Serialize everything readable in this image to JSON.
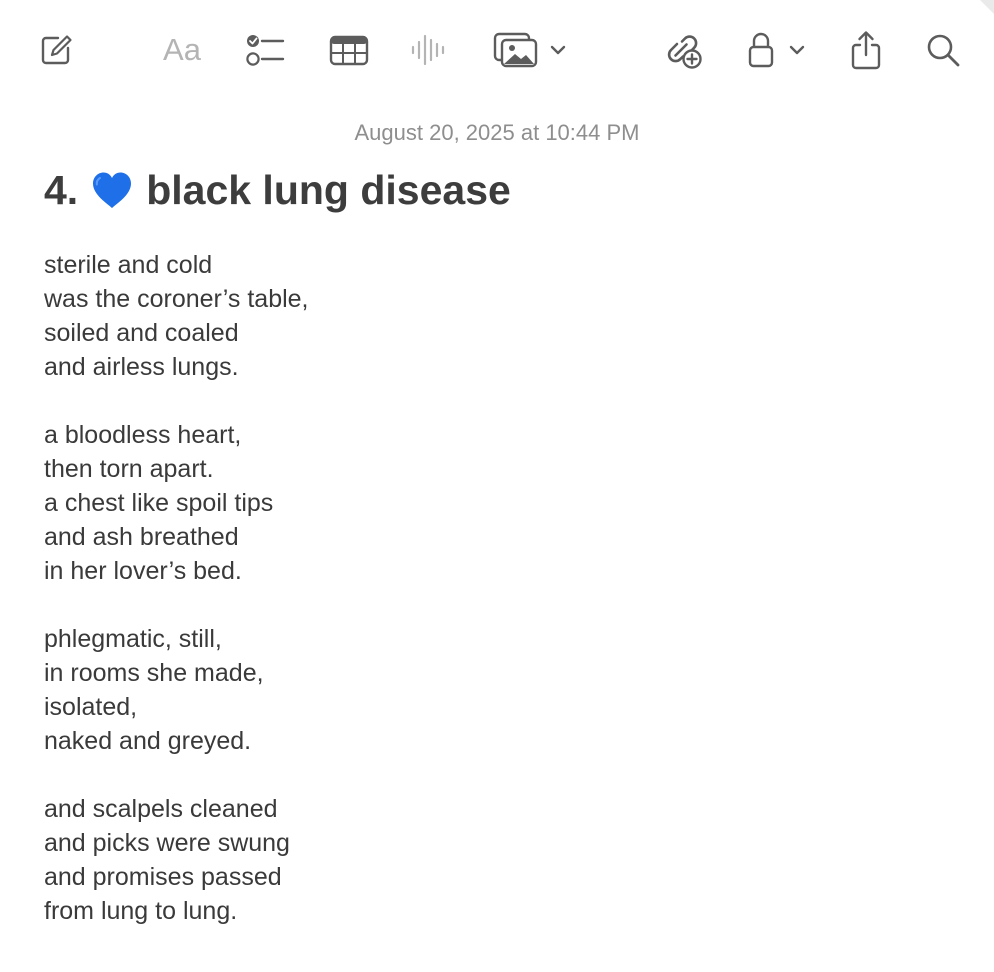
{
  "toolbar": {
    "items": [
      {
        "name": "compose-icon"
      },
      {
        "name": "text-format-aa",
        "label": "Aa"
      },
      {
        "name": "checklist-icon"
      },
      {
        "name": "table-icon"
      },
      {
        "name": "audio-waveform-icon"
      },
      {
        "name": "media-icon"
      },
      {
        "name": "link-add-icon"
      },
      {
        "name": "lock-icon"
      },
      {
        "name": "share-icon"
      },
      {
        "name": "search-icon"
      }
    ],
    "format_label": "Aa"
  },
  "note": {
    "date": "August 20, 2025 at 10:44 PM",
    "title_prefix": "4.",
    "title_emoji": "blue-heart-emoji",
    "title_text": "black lung disease",
    "stanzas": [
      [
        "sterile and cold",
        "was the coroner’s table,",
        "soiled and coaled",
        "and airless lungs."
      ],
      [
        "a bloodless heart,",
        "then torn apart.",
        "a chest like spoil tips",
        "and ash breathed",
        "in her lover’s bed."
      ],
      [
        "phlegmatic, still,",
        "in rooms she made,",
        "isolated,",
        "naked and greyed."
      ],
      [
        "and scalpels cleaned",
        "and picks were swung",
        "and promises passed",
        "from lung to lung."
      ]
    ]
  },
  "colors": {
    "icon": "#5c5c5c",
    "icon_disabled": "#b4b4b4",
    "heart": "#1e6fe8",
    "date": "#8e8e8e"
  }
}
